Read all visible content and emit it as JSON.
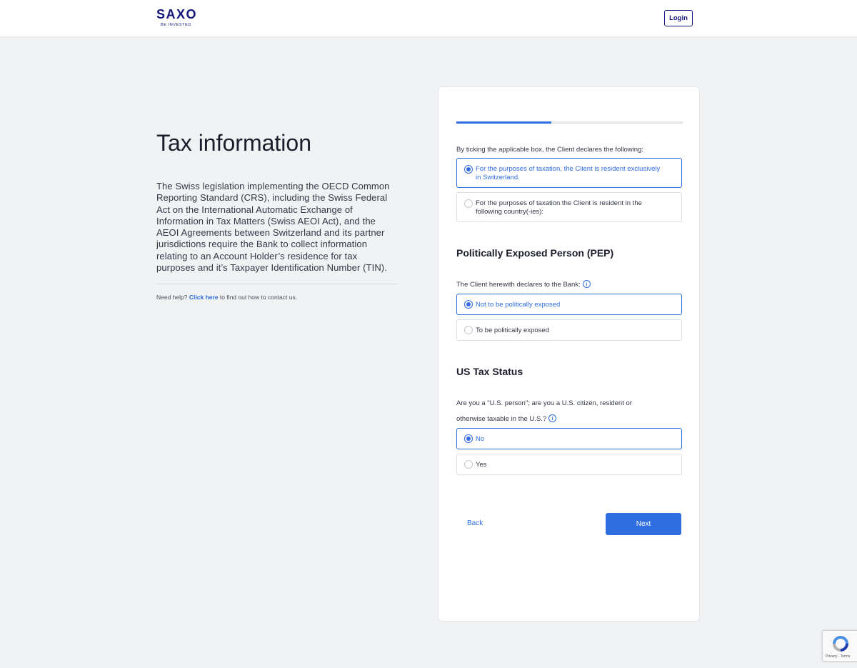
{
  "header": {
    "logo": "SAXO",
    "tagline": "BE INVESTED",
    "login_label": "Login"
  },
  "left": {
    "title": "Tax information",
    "intro": "The Swiss legislation implementing the OECD Common Reporting Standard (CRS), including the Swiss Federal Act on the International Automatic Exchange of Information in Tax Matters (Swiss AEOI Act), and the AEOI Agreements between Switzerland and its partner jurisdictions require the Bank to collect information relating to an Account Holder’s residence for tax purposes and it’s Taxpayer Identification Number (TIN).",
    "help_prefix": "Need help?",
    "help_link": "Click here",
    "help_suffix": "to find out how to contact us."
  },
  "form": {
    "progress": 0.42,
    "residency": {
      "question": "By ticking the applicable box, the Client declares the following:",
      "options": [
        {
          "label": "For the purposes of taxation, the Client is resident exclusively in Switzerland.",
          "selected": true
        },
        {
          "label": "For the purposes of taxation the Client is resident in the following country(-ies):",
          "selected": false
        }
      ]
    },
    "pep": {
      "title": "Politically Exposed Person (PEP)",
      "question": "The Client herewith declares to the Bank:",
      "options": [
        {
          "label": "Not to be politically exposed",
          "selected": true
        },
        {
          "label": "To be politically exposed",
          "selected": false
        }
      ]
    },
    "us_tax": {
      "title": "US Tax Status",
      "question_line1": "Are you a \"U.S. person\"; are you a U.S. citizen, resident or",
      "question_line2": "otherwise taxable in the U.S.?",
      "options": [
        {
          "label": "No",
          "selected": true
        },
        {
          "label": "Yes",
          "selected": false
        }
      ]
    },
    "back_label": "Back",
    "next_label": "Next"
  },
  "recaptcha": {
    "footer": "Privacy - Terms"
  },
  "colors": {
    "brand": "#14167a",
    "accent": "#2f6de0",
    "background": "#f1f2f4"
  }
}
